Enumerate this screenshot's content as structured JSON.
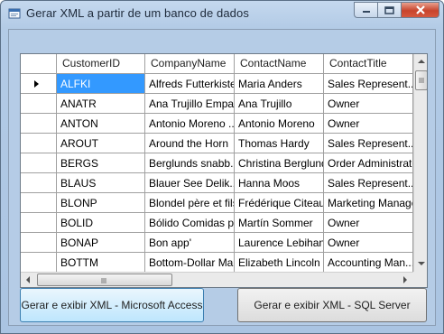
{
  "window": {
    "title": "Gerar XML a partir de um banco de dados"
  },
  "grid": {
    "columns": [
      "CustomerID",
      "CompanyName",
      "ContactName",
      "ContactTitle"
    ],
    "rows": [
      [
        "ALFKI",
        "Alfreds Futterkiste",
        "Maria Anders",
        "Sales Represent..."
      ],
      [
        "ANATR",
        "Ana Trujillo Empa...",
        "Ana Trujillo",
        "Owner"
      ],
      [
        "ANTON",
        "Antonio Moreno ...",
        "Antonio Moreno",
        "Owner"
      ],
      [
        "AROUT",
        "Around the Horn",
        "Thomas Hardy",
        "Sales Represent..."
      ],
      [
        "BERGS",
        "Berglunds snabb...",
        "Christina Berglund",
        "Order Administrator"
      ],
      [
        "BLAUS",
        "Blauer See Delik...",
        "Hanna Moos",
        "Sales Represent..."
      ],
      [
        "BLONP",
        "Blondel père et fils",
        "Frédérique Citeaux",
        "Marketing Manager"
      ],
      [
        "BOLID",
        "Bólido Comidas p...",
        "Martín Sommer",
        "Owner"
      ],
      [
        "BONAP",
        "Bon app'",
        "Laurence Lebihan",
        "Owner"
      ],
      [
        "BOTTM",
        "Bottom-Dollar Ma...",
        "Elizabeth Lincoln",
        "Accounting Man..."
      ]
    ],
    "selected_row": 0
  },
  "buttons": {
    "access": "Gerar e exibir XML - Microsoft Access",
    "sql": "Gerar e exibir XML - SQL Server"
  },
  "colors": {
    "selection": "#3399ff",
    "close_button": "#c8442c"
  }
}
